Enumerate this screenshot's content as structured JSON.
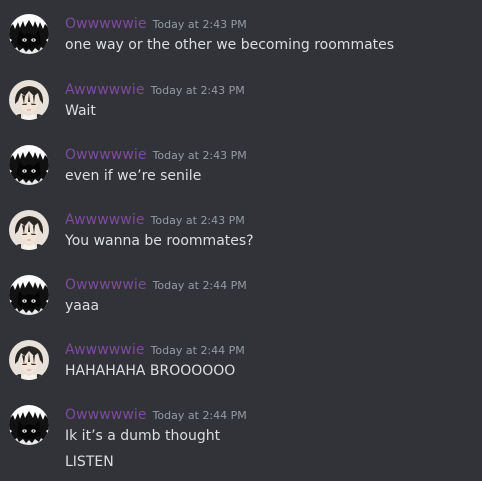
{
  "messages": [
    {
      "username": "Owwwwwie",
      "timestamp": "Today at 2:43 PM",
      "avatar": "black-cat-avatar",
      "lines": [
        "one way or the other we becoming roommates"
      ]
    },
    {
      "username": "Awwwwwie",
      "timestamp": "Today at 2:43 PM",
      "avatar": "anime-boy-avatar",
      "lines": [
        "Wait"
      ]
    },
    {
      "username": "Owwwwwie",
      "timestamp": "Today at 2:43 PM",
      "avatar": "black-cat-avatar",
      "lines": [
        "even if we’re senile"
      ]
    },
    {
      "username": "Awwwwwie",
      "timestamp": "Today at 2:43 PM",
      "avatar": "anime-boy-avatar",
      "lines": [
        "You wanna be roommates?"
      ]
    },
    {
      "username": "Owwwwwie",
      "timestamp": "Today at 2:44 PM",
      "avatar": "black-cat-avatar",
      "lines": [
        "yaaa"
      ]
    },
    {
      "username": "Awwwwwie",
      "timestamp": "Today at 2:44 PM",
      "avatar": "anime-boy-avatar",
      "lines": [
        "HAHAHAHA BROOOOOO"
      ]
    },
    {
      "username": "Owwwwwie",
      "timestamp": "Today at 2:44 PM",
      "avatar": "black-cat-avatar",
      "lines": [
        "Ik it’s a dumb thought",
        "LISTEN"
      ]
    }
  ],
  "colors": {
    "background": "#313338",
    "username": "#7e4a9e",
    "timestamp": "#949ba4",
    "text": "#dbdee1"
  }
}
